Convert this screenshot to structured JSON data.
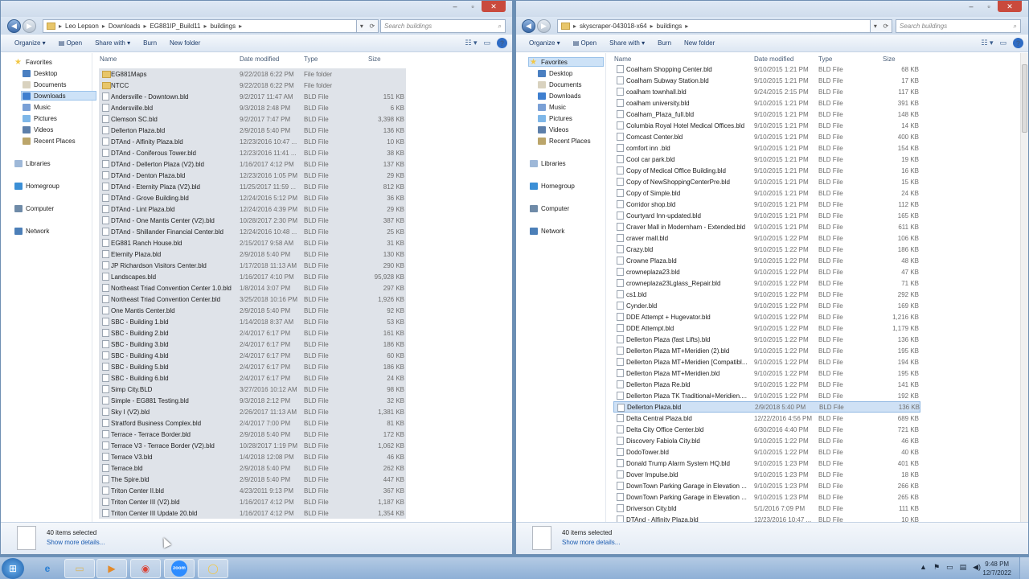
{
  "colors": {
    "accent": "#cde2f7",
    "selected_row": "#dfe3e9",
    "link": "#1a5bb0",
    "close_button": "#c94a3d"
  },
  "left_window": {
    "breadcrumb": [
      "Leo Lepson",
      "Downloads",
      "EG881IP_Build11",
      "buildings"
    ],
    "search_placeholder": "Search buildings",
    "toolbar": {
      "organize": "Organize ▾",
      "open": "Open",
      "share_with": "Share with ▾",
      "burn": "Burn",
      "new_folder": "New folder"
    },
    "nav": {
      "favorites": "Favorites",
      "desktop": "Desktop",
      "documents": "Documents",
      "downloads": "Downloads",
      "music": "Music",
      "pictures": "Pictures",
      "videos": "Videos",
      "recent_places": "Recent Places",
      "libraries": "Libraries",
      "homegroup": "Homegroup",
      "computer": "Computer",
      "network": "Network"
    },
    "columns": {
      "name": "Name",
      "date": "Date modified",
      "type": "Type",
      "size": "Size"
    },
    "files": [
      {
        "name": "EG881Maps",
        "date": "9/22/2018 6:22 PM",
        "type": "File folder",
        "size": "",
        "folder": true
      },
      {
        "name": "NTCC",
        "date": "9/22/2018 6:22 PM",
        "type": "File folder",
        "size": "",
        "folder": true
      },
      {
        "name": "Andersville - Downtown.bld",
        "date": "9/2/2017 11:47 AM",
        "type": "BLD File",
        "size": "151 KB"
      },
      {
        "name": "Andersville.bld",
        "date": "9/3/2018 2:48 PM",
        "type": "BLD File",
        "size": "6 KB"
      },
      {
        "name": "Clemson SC.bld",
        "date": "9/2/2017 7:47 PM",
        "type": "BLD File",
        "size": "3,398 KB"
      },
      {
        "name": "Dellerton Plaza.bld",
        "date": "2/9/2018 5:40 PM",
        "type": "BLD File",
        "size": "136 KB"
      },
      {
        "name": "DTAnd - Alfinity Plaza.bld",
        "date": "12/23/2016 10:47 ...",
        "type": "BLD File",
        "size": "10 KB"
      },
      {
        "name": "DTAnd - Coniferous Tower.bld",
        "date": "12/23/2016 11:41 ...",
        "type": "BLD File",
        "size": "38 KB"
      },
      {
        "name": "DTAnd - Dellerton Plaza (V2).bld",
        "date": "1/16/2017 4:12 PM",
        "type": "BLD File",
        "size": "137 KB"
      },
      {
        "name": "DTAnd - Denton Plaza.bld",
        "date": "12/23/2016 1:05 PM",
        "type": "BLD File",
        "size": "29 KB"
      },
      {
        "name": "DTAnd - Eternity Plaza (V2).bld",
        "date": "11/25/2017 11:59 ...",
        "type": "BLD File",
        "size": "812 KB"
      },
      {
        "name": "DTAnd - Grove Building.bld",
        "date": "12/24/2016 5:12 PM",
        "type": "BLD File",
        "size": "36 KB"
      },
      {
        "name": "DTAnd - Lint Plaza.bld",
        "date": "12/24/2016 4:39 PM",
        "type": "BLD File",
        "size": "29 KB"
      },
      {
        "name": "DTAnd - One Mantis Center (V2).bld",
        "date": "10/28/2017 2:30 PM",
        "type": "BLD File",
        "size": "387 KB"
      },
      {
        "name": "DTAnd - Shillander Financial Center.bld",
        "date": "12/24/2016 10:48 ...",
        "type": "BLD File",
        "size": "25 KB"
      },
      {
        "name": "EG881 Ranch House.bld",
        "date": "2/15/2017 9:58 AM",
        "type": "BLD File",
        "size": "31 KB"
      },
      {
        "name": "Eternity Plaza.bld",
        "date": "2/9/2018 5:40 PM",
        "type": "BLD File",
        "size": "130 KB"
      },
      {
        "name": "JP Richardson Visitors Center.bld",
        "date": "1/17/2018 11:13 AM",
        "type": "BLD File",
        "size": "290 KB"
      },
      {
        "name": "Landscapes.bld",
        "date": "1/16/2017 4:10 PM",
        "type": "BLD File",
        "size": "95,928 KB"
      },
      {
        "name": "Northeast Triad Convention Center 1.0.bld",
        "date": "1/8/2014 3:07 PM",
        "type": "BLD File",
        "size": "297 KB"
      },
      {
        "name": "Northeast Triad Convention Center.bld",
        "date": "3/25/2018 10:16 PM",
        "type": "BLD File",
        "size": "1,926 KB"
      },
      {
        "name": "One Mantis Center.bld",
        "date": "2/9/2018 5:40 PM",
        "type": "BLD File",
        "size": "92 KB"
      },
      {
        "name": "SBC - Building 1.bld",
        "date": "1/14/2018 8:37 AM",
        "type": "BLD File",
        "size": "53 KB"
      },
      {
        "name": "SBC - Building 2.bld",
        "date": "2/4/2017 6:17 PM",
        "type": "BLD File",
        "size": "161 KB"
      },
      {
        "name": "SBC - Building 3.bld",
        "date": "2/4/2017 6:17 PM",
        "type": "BLD File",
        "size": "186 KB"
      },
      {
        "name": "SBC - Building 4.bld",
        "date": "2/4/2017 6:17 PM",
        "type": "BLD File",
        "size": "60 KB"
      },
      {
        "name": "SBC - Building 5.bld",
        "date": "2/4/2017 6:17 PM",
        "type": "BLD File",
        "size": "186 KB"
      },
      {
        "name": "SBC - Building 6.bld",
        "date": "2/4/2017 6:17 PM",
        "type": "BLD File",
        "size": "24 KB"
      },
      {
        "name": "Simp City.BLD",
        "date": "3/27/2016 10:12 AM",
        "type": "BLD File",
        "size": "98 KB"
      },
      {
        "name": "Simple - EG881 Testing.bld",
        "date": "9/3/2018 2:12 PM",
        "type": "BLD File",
        "size": "32 KB"
      },
      {
        "name": "Sky I (V2).bld",
        "date": "2/26/2017 11:13 AM",
        "type": "BLD File",
        "size": "1,381 KB"
      },
      {
        "name": "Stratford Business Complex.bld",
        "date": "2/4/2017 7:00 PM",
        "type": "BLD File",
        "size": "81 KB"
      },
      {
        "name": "Terrace - Terrace Border.bld",
        "date": "2/9/2018 5:40 PM",
        "type": "BLD File",
        "size": "172 KB"
      },
      {
        "name": "Terrace V3 - Terrace Border (V2).bld",
        "date": "10/28/2017 1:19 PM",
        "type": "BLD File",
        "size": "1,062 KB"
      },
      {
        "name": "Terrace V3.bld",
        "date": "1/4/2018 12:08 PM",
        "type": "BLD File",
        "size": "46 KB"
      },
      {
        "name": "Terrace.bld",
        "date": "2/9/2018 5:40 PM",
        "type": "BLD File",
        "size": "262 KB"
      },
      {
        "name": "The Spire.bld",
        "date": "2/9/2018 5:40 PM",
        "type": "BLD File",
        "size": "447 KB"
      },
      {
        "name": "Triton Center II.bld",
        "date": "4/23/2011 9:13 PM",
        "type": "BLD File",
        "size": "367 KB"
      },
      {
        "name": "Triton Center III (V2).bld",
        "date": "1/16/2017 4:12 PM",
        "type": "BLD File",
        "size": "1,187 KB"
      },
      {
        "name": "Triton Center III Update 20.bld",
        "date": "1/16/2017 4:12 PM",
        "type": "BLD File",
        "size": "1,354 KB"
      }
    ],
    "status": {
      "count": "40 items selected",
      "more": "Show more details..."
    }
  },
  "right_window": {
    "breadcrumb": [
      "skyscraper-043018-x64",
      "buildings"
    ],
    "search_placeholder": "Search buildings",
    "toolbar": {
      "organize": "Organize ▾",
      "open": "Open",
      "share_with": "Share with ▾",
      "burn": "Burn",
      "new_folder": "New folder"
    },
    "nav": {
      "favorites": "Favorites",
      "desktop": "Desktop",
      "documents": "Documents",
      "downloads": "Downloads",
      "music": "Music",
      "pictures": "Pictures",
      "videos": "Videos",
      "recent_places": "Recent Places",
      "libraries": "Libraries",
      "homegroup": "Homegroup",
      "computer": "Computer",
      "network": "Network"
    },
    "columns": {
      "name": "Name",
      "date": "Date modified",
      "type": "Type",
      "size": "Size"
    },
    "files": [
      {
        "name": "Coalham Shopping Center.bld",
        "date": "9/10/2015 1:21 PM",
        "type": "BLD File",
        "size": "68 KB"
      },
      {
        "name": "Coalham Subway Station.bld",
        "date": "9/10/2015 1:21 PM",
        "type": "BLD File",
        "size": "17 KB"
      },
      {
        "name": "coalham townhall.bld",
        "date": "9/24/2015 2:15 PM",
        "type": "BLD File",
        "size": "117 KB"
      },
      {
        "name": "coalham university.bld",
        "date": "9/10/2015 1:21 PM",
        "type": "BLD File",
        "size": "391 KB"
      },
      {
        "name": "Coalham_Plaza_full.bld",
        "date": "9/10/2015 1:21 PM",
        "type": "BLD File",
        "size": "148 KB"
      },
      {
        "name": "Columbia Royal Hotel Medical Offices.bld",
        "date": "9/10/2015 1:21 PM",
        "type": "BLD File",
        "size": "14 KB"
      },
      {
        "name": "Comcast Center.bld",
        "date": "9/10/2015 1:21 PM",
        "type": "BLD File",
        "size": "400 KB"
      },
      {
        "name": "comfort inn .bld",
        "date": "9/10/2015 1:21 PM",
        "type": "BLD File",
        "size": "154 KB"
      },
      {
        "name": "Cool car park.bld",
        "date": "9/10/2015 1:21 PM",
        "type": "BLD File",
        "size": "19 KB"
      },
      {
        "name": "Copy of Medical Office Building.bld",
        "date": "9/10/2015 1:21 PM",
        "type": "BLD File",
        "size": "16 KB"
      },
      {
        "name": "Copy of NewShoppingCenterPre.bld",
        "date": "9/10/2015 1:21 PM",
        "type": "BLD File",
        "size": "15 KB"
      },
      {
        "name": "Copy of Simple.bld",
        "date": "9/10/2015 1:21 PM",
        "type": "BLD File",
        "size": "24 KB"
      },
      {
        "name": "Corridor shop.bld",
        "date": "9/10/2015 1:21 PM",
        "type": "BLD File",
        "size": "112 KB"
      },
      {
        "name": "Courtyard Inn-updated.bld",
        "date": "9/10/2015 1:21 PM",
        "type": "BLD File",
        "size": "165 KB"
      },
      {
        "name": "Craver Mall in Modernham - Extended.bld",
        "date": "9/10/2015 1:21 PM",
        "type": "BLD File",
        "size": "611 KB"
      },
      {
        "name": "craver mall.bld",
        "date": "9/10/2015 1:22 PM",
        "type": "BLD File",
        "size": "106 KB"
      },
      {
        "name": "Crazy.bld",
        "date": "9/10/2015 1:22 PM",
        "type": "BLD File",
        "size": "186 KB"
      },
      {
        "name": "Crowne Plaza.bld",
        "date": "9/10/2015 1:22 PM",
        "type": "BLD File",
        "size": "48 KB"
      },
      {
        "name": "crowneplaza23.bld",
        "date": "9/10/2015 1:22 PM",
        "type": "BLD File",
        "size": "47 KB"
      },
      {
        "name": "crowneplaza23Lglass_Repair.bld",
        "date": "9/10/2015 1:22 PM",
        "type": "BLD File",
        "size": "71 KB"
      },
      {
        "name": "cs1.bld",
        "date": "9/10/2015 1:22 PM",
        "type": "BLD File",
        "size": "292 KB"
      },
      {
        "name": "Cynder.bld",
        "date": "9/10/2015 1:22 PM",
        "type": "BLD File",
        "size": "169 KB"
      },
      {
        "name": "DDE Attempt + Hugevator.bld",
        "date": "9/10/2015 1:22 PM",
        "type": "BLD File",
        "size": "1,216 KB"
      },
      {
        "name": "DDE Attempt.bld",
        "date": "9/10/2015 1:22 PM",
        "type": "BLD File",
        "size": "1,179 KB"
      },
      {
        "name": "Dellerton Plaza (fast Lifts).bld",
        "date": "9/10/2015 1:22 PM",
        "type": "BLD File",
        "size": "136 KB"
      },
      {
        "name": "Dellerton Plaza MT+Meridien (2).bld",
        "date": "9/10/2015 1:22 PM",
        "type": "BLD File",
        "size": "195 KB"
      },
      {
        "name": "Dellerton Plaza MT+Meridien [Compatibl...",
        "date": "9/10/2015 1:22 PM",
        "type": "BLD File",
        "size": "194 KB"
      },
      {
        "name": "Dellerton Plaza MT+Meridien.bld",
        "date": "9/10/2015 1:22 PM",
        "type": "BLD File",
        "size": "195 KB"
      },
      {
        "name": "Dellerton Plaza Re.bld",
        "date": "9/10/2015 1:22 PM",
        "type": "BLD File",
        "size": "141 KB"
      },
      {
        "name": "Dellerton Plaza TK Traditional+Meridien....",
        "date": "9/10/2015 1:22 PM",
        "type": "BLD File",
        "size": "192 KB"
      },
      {
        "name": "Dellerton Plaza.bld",
        "date": "2/9/2018 5:40 PM",
        "type": "BLD File",
        "size": "136 KB",
        "highlight": true
      },
      {
        "name": "Delta Central Plaza.bld",
        "date": "12/22/2016 4:56 PM",
        "type": "BLD File",
        "size": "689 KB"
      },
      {
        "name": "Delta City Office Center.bld",
        "date": "6/30/2016 4:40 PM",
        "type": "BLD File",
        "size": "721 KB"
      },
      {
        "name": "Discovery Fabiola City.bld",
        "date": "9/10/2015 1:22 PM",
        "type": "BLD File",
        "size": "46 KB"
      },
      {
        "name": "DodoTower.bld",
        "date": "9/10/2015 1:22 PM",
        "type": "BLD File",
        "size": "40 KB"
      },
      {
        "name": "Donald Trump Alarm System HQ.bld",
        "date": "9/10/2015 1:23 PM",
        "type": "BLD File",
        "size": "401 KB"
      },
      {
        "name": "Dover Impulse.bld",
        "date": "9/10/2015 1:23 PM",
        "type": "BLD File",
        "size": "18 KB"
      },
      {
        "name": "DownTown Parking Garage in Elevation ...",
        "date": "9/10/2015 1:23 PM",
        "type": "BLD File",
        "size": "266 KB"
      },
      {
        "name": "DownTown Parking Garage in Elevation ...",
        "date": "9/10/2015 1:23 PM",
        "type": "BLD File",
        "size": "265 KB"
      },
      {
        "name": "Driverson City.bld",
        "date": "5/1/2016 7:09 PM",
        "type": "BLD File",
        "size": "111 KB"
      },
      {
        "name": "DTAnd - Alfinity Plaza.bld",
        "date": "12/23/2016 10:47 ...",
        "type": "BLD File",
        "size": "10 KB"
      }
    ],
    "status": {
      "count": "40 items selected",
      "more": "Show more details..."
    }
  },
  "taskbar": {
    "apps": [
      {
        "icon": "ie-icon",
        "glyph": "e"
      },
      {
        "icon": "explorer-icon",
        "glyph": "▭"
      },
      {
        "icon": "media-player-icon",
        "glyph": "▶"
      },
      {
        "icon": "chrome-icon",
        "glyph": "◉"
      },
      {
        "icon": "zoom-icon",
        "glyph": "zoom"
      },
      {
        "icon": "app-icon",
        "glyph": "◯"
      }
    ],
    "time": "9:48 PM",
    "date": "12/7/2022"
  }
}
